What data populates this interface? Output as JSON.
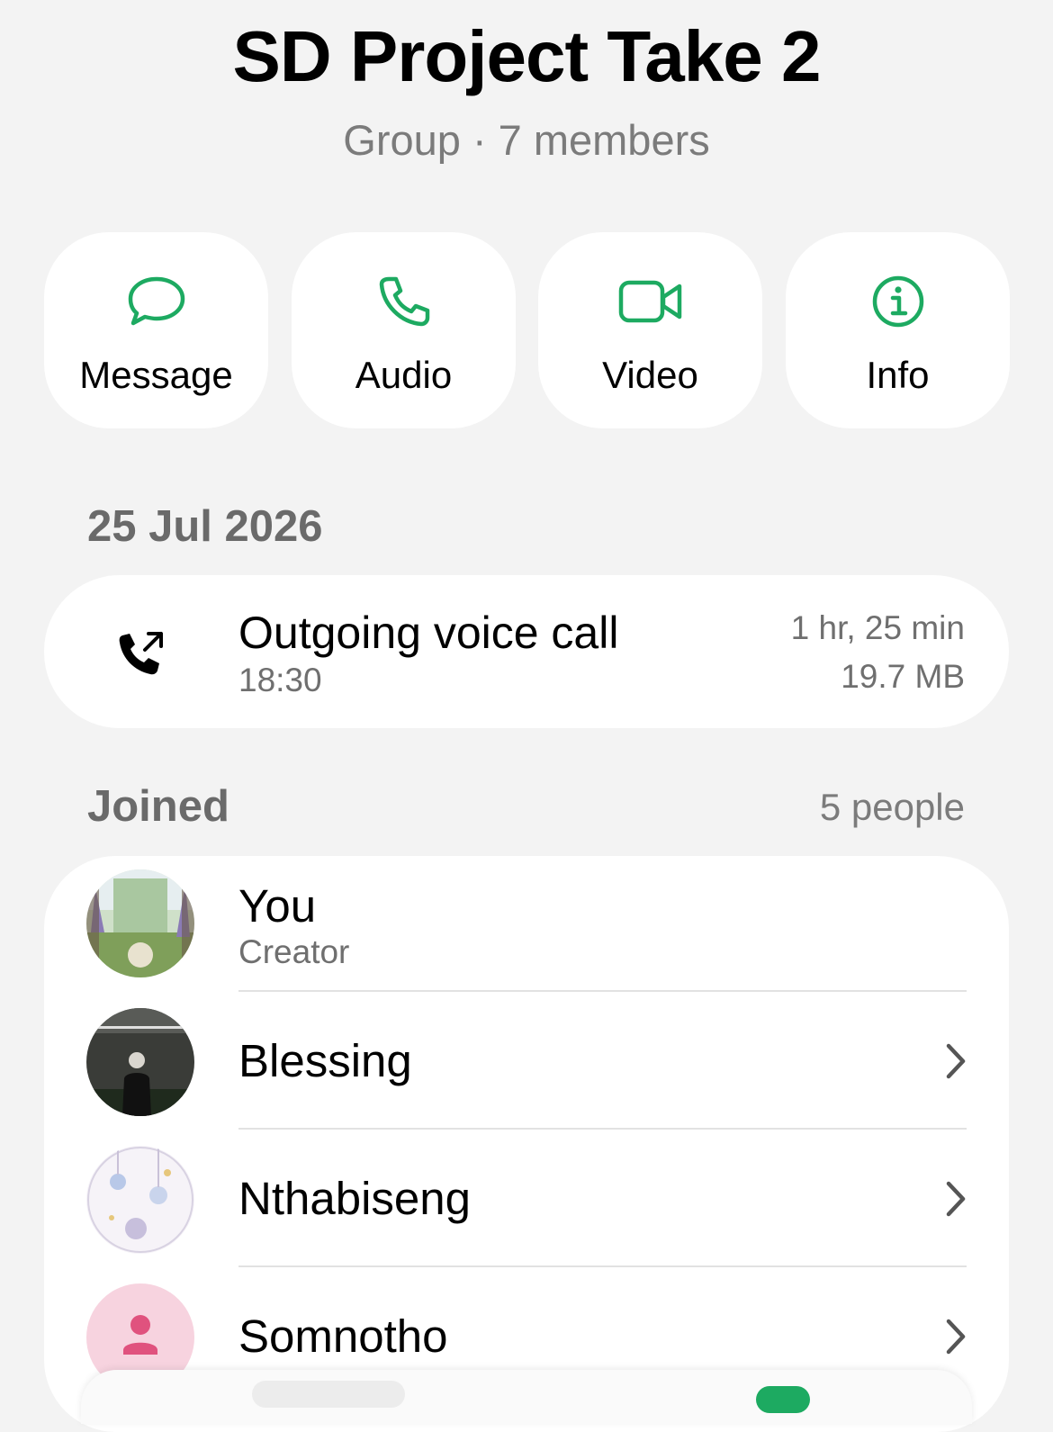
{
  "header": {
    "title": "SD Project Take 2",
    "subtitle": "Group · 7 members"
  },
  "actions": [
    {
      "label": "Message",
      "icon": "chat-bubble-icon"
    },
    {
      "label": "Audio",
      "icon": "phone-icon"
    },
    {
      "label": "Video",
      "icon": "video-camera-icon"
    },
    {
      "label": "Info",
      "icon": "info-icon"
    }
  ],
  "colors": {
    "accent": "#1daa61",
    "background": "#f3f3f3",
    "card": "#ffffff",
    "secondary_text": "#6f6f6f"
  },
  "call_log": {
    "date": "25 Jul 2026",
    "title": "Outgoing voice call",
    "time": "18:30",
    "duration": "1 hr, 25 min",
    "size": "19.7 MB",
    "icon": "outgoing-call-icon"
  },
  "joined": {
    "label": "Joined",
    "count": "5 people",
    "members": [
      {
        "name": "You",
        "role": "Creator"
      },
      {
        "name": "Blessing"
      },
      {
        "name": "Nthabiseng"
      },
      {
        "name": "Somnotho"
      }
    ]
  }
}
